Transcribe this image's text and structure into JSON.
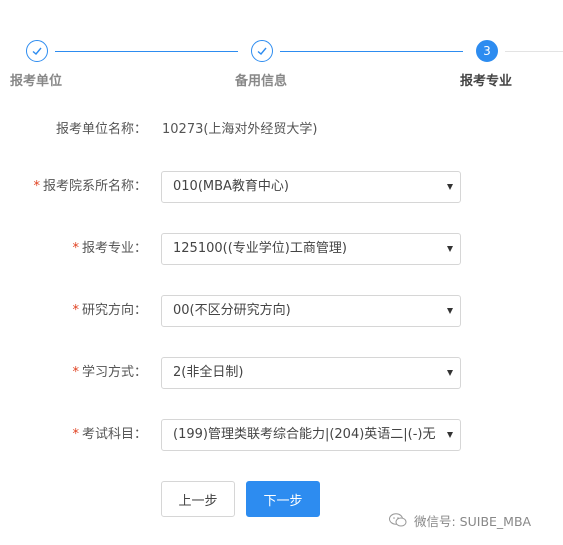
{
  "stepper": {
    "steps": [
      {
        "label": "报考单位",
        "status": "done",
        "icon": "check-icon"
      },
      {
        "label": "备用信息",
        "status": "done",
        "icon": "check-icon"
      },
      {
        "label": "报考专业",
        "status": "active",
        "number": "3"
      }
    ],
    "accent_color": "#2d8cf0"
  },
  "form": {
    "unit": {
      "label": "报考单位名称：",
      "value": "10273(上海对外经贸大学)"
    },
    "department": {
      "required": "*",
      "label": "报考院系所名称：",
      "value": "010(MBA教育中心)"
    },
    "major": {
      "required": "*",
      "label": "报考专业：",
      "value": "125100((专业学位)工商管理)"
    },
    "direction": {
      "required": "*",
      "label": "研究方向：",
      "value": "00(不区分研究方向)"
    },
    "study_mode": {
      "required": "*",
      "label": "学习方式：",
      "value": "2(非全日制)"
    },
    "exam_subjects": {
      "required": "*",
      "label": "考试科目：",
      "value": "(199)管理类联考综合能力|(204)英语二|(-)无"
    }
  },
  "buttons": {
    "prev": "上一步",
    "next": "下一步"
  },
  "watermark": {
    "text": "微信号: SUIBE_MBA",
    "icon": "wechat-icon"
  }
}
